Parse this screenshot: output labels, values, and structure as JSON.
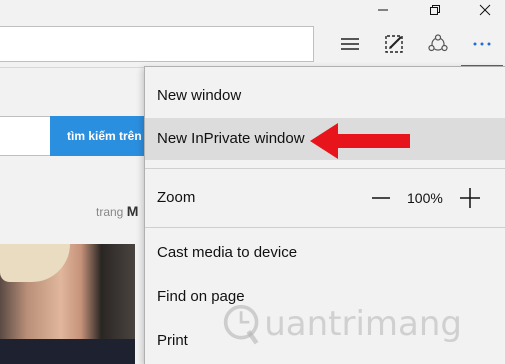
{
  "page": {
    "search_button_label": "tìm kiếm trên",
    "sub_prefix": "trang",
    "sub_letter": "M"
  },
  "menu": {
    "items": {
      "new_window": "New window",
      "new_inprivate_window": "New InPrivate window",
      "zoom": "Zoom",
      "cast_media": "Cast media to device",
      "find_on_page": "Find on page",
      "print": "Print"
    },
    "zoom_value": "100%"
  },
  "watermark": {
    "text": "uantrimang"
  },
  "colors": {
    "accent": "#1e6fd0",
    "search_button": "#2b8fe0",
    "arrow": "#e8141b",
    "highlight": "#dcdcdc"
  }
}
